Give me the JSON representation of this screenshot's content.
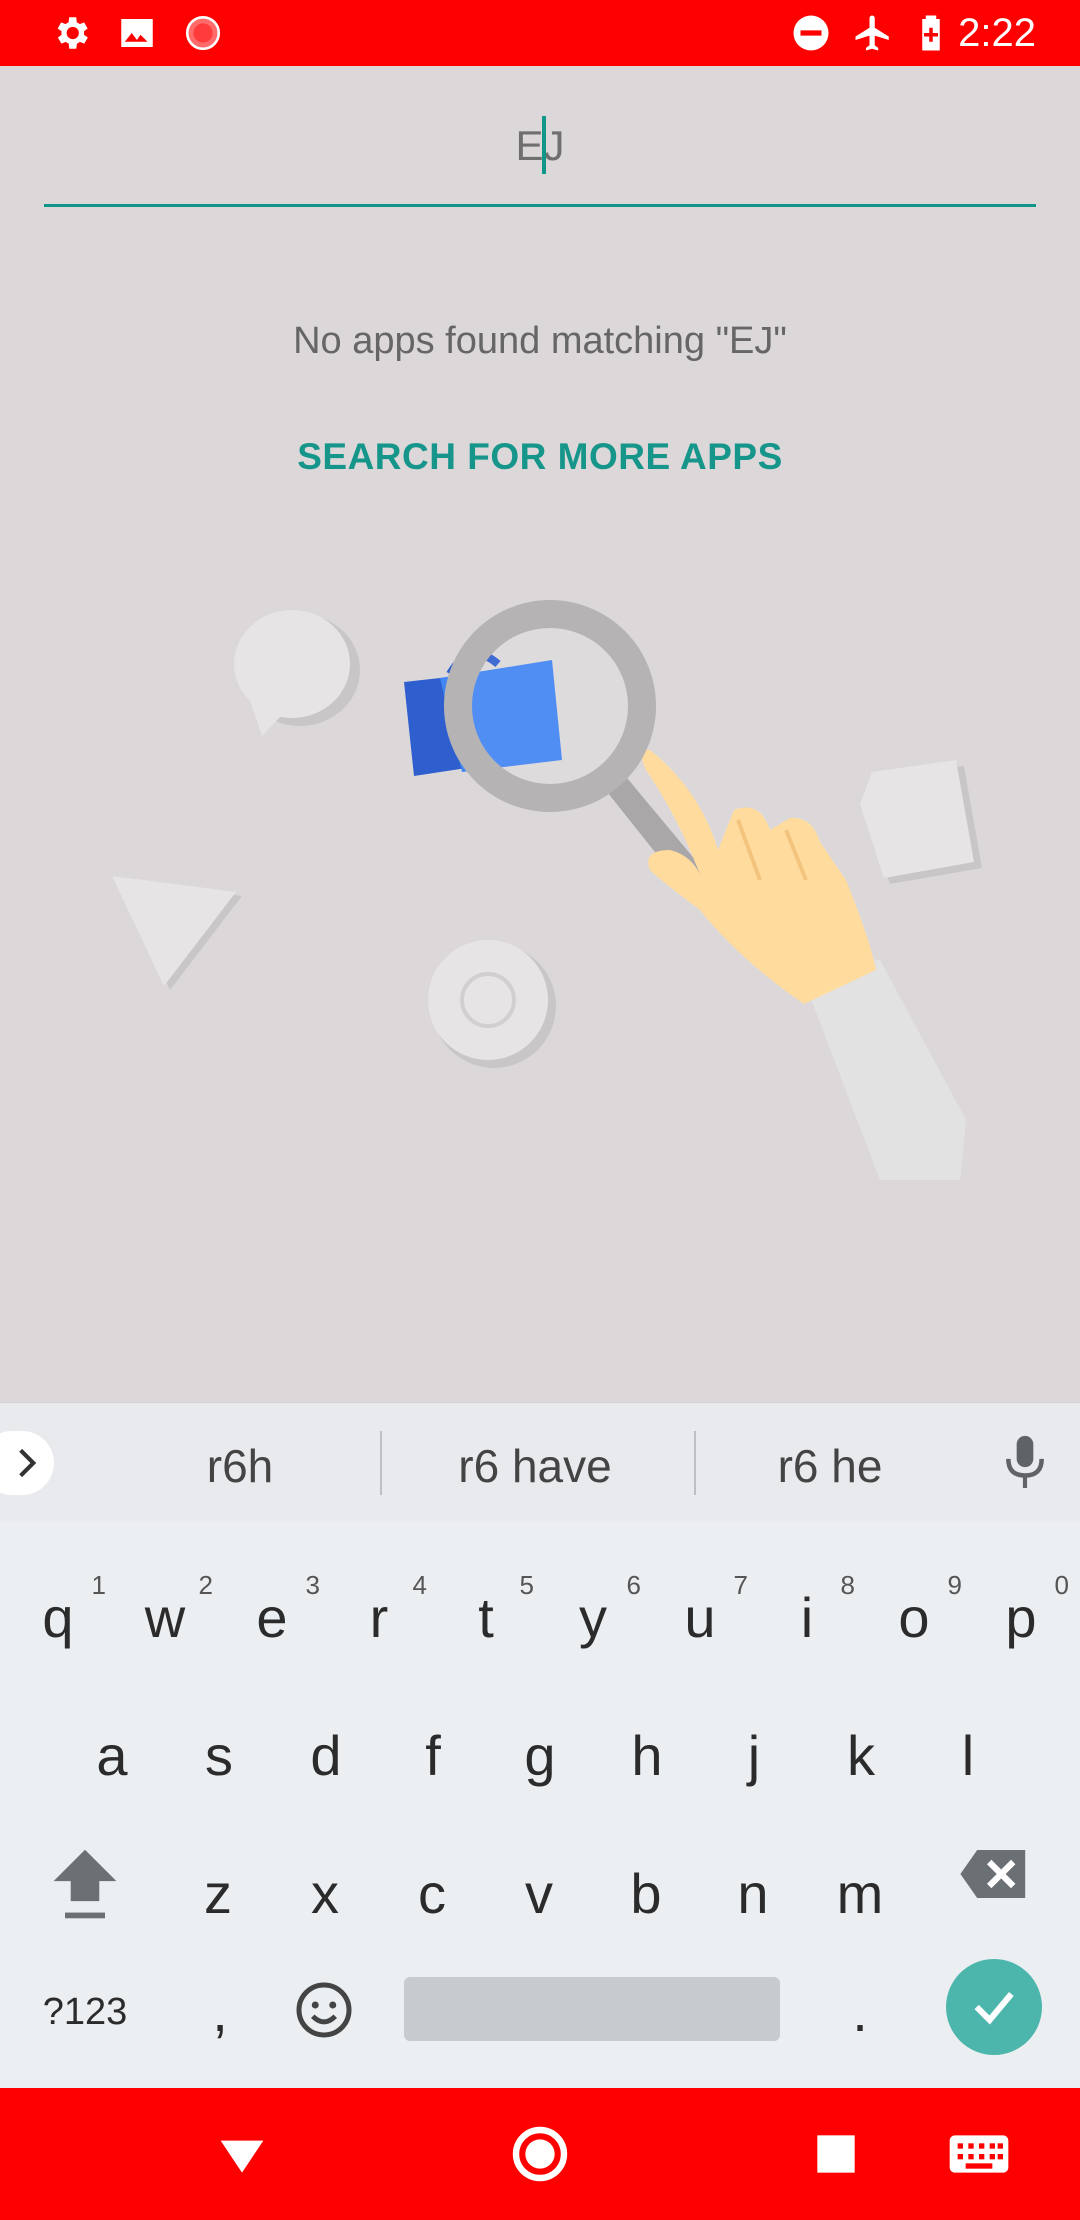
{
  "status_bar": {
    "time": "2:22",
    "left_icons": [
      "gear-icon",
      "image-icon",
      "record-icon"
    ],
    "right_icons": [
      "do-not-disturb-icon",
      "airplane-mode-icon",
      "battery-charging-icon"
    ]
  },
  "search": {
    "query_before_cursor": "E",
    "query_after_cursor": "J",
    "accent_color": "#11968a"
  },
  "results": {
    "empty_message": "No apps found matching \"EJ\"",
    "more_apps_label": "SEARCH FOR MORE APPS"
  },
  "keyboard": {
    "suggestions": [
      "r6h",
      "r6 have",
      "r6 he"
    ],
    "row1": [
      {
        "k": "q",
        "h": "1"
      },
      {
        "k": "w",
        "h": "2"
      },
      {
        "k": "e",
        "h": "3"
      },
      {
        "k": "r",
        "h": "4"
      },
      {
        "k": "t",
        "h": "5"
      },
      {
        "k": "y",
        "h": "6"
      },
      {
        "k": "u",
        "h": "7"
      },
      {
        "k": "i",
        "h": "8"
      },
      {
        "k": "o",
        "h": "9"
      },
      {
        "k": "p",
        "h": "0"
      }
    ],
    "row2": [
      "a",
      "s",
      "d",
      "f",
      "g",
      "h",
      "j",
      "k",
      "l"
    ],
    "row3": [
      "z",
      "x",
      "c",
      "v",
      "b",
      "n",
      "m"
    ],
    "symbols_label": "?123",
    "comma": ",",
    "period": "."
  },
  "nav_bar": {
    "buttons": [
      "back-icon",
      "home-icon",
      "recents-icon",
      "keyboard-switch-icon"
    ],
    "color": "#ff0000"
  }
}
